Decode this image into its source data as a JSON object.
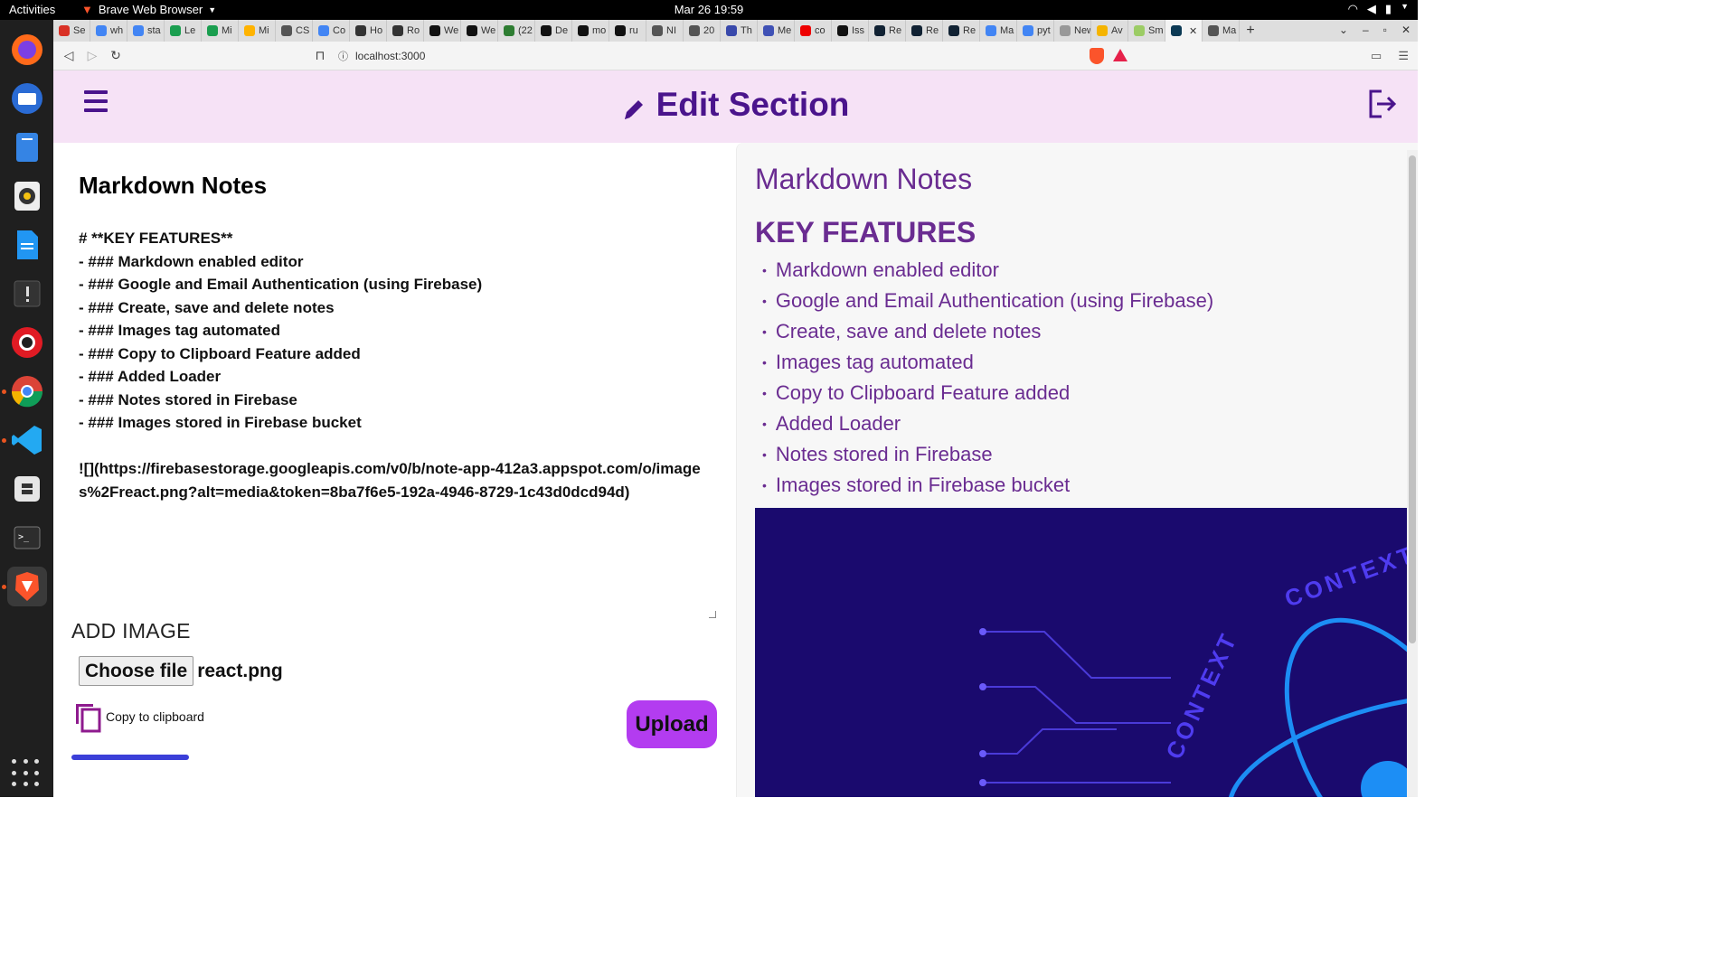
{
  "system_bar": {
    "activities": "Activities",
    "app_name": "Brave Web Browser",
    "clock": "Mar 26  19:59"
  },
  "dock": {
    "items": [
      "firefox-icon",
      "thunderbird-icon",
      "files-icon",
      "rhythmbox-icon",
      "writer-icon",
      "terminal-dark-icon",
      "help-icon",
      "chrome-icon",
      "vscode-icon",
      "software-icon",
      "terminal-icon",
      "brave-icon"
    ]
  },
  "browser": {
    "tabs": [
      "Se",
      "wh",
      "sta",
      "Le",
      "Mi",
      "Mi",
      "CS",
      "Co",
      "Ho",
      "Ro",
      "We",
      "We",
      "(22",
      "De",
      "mo",
      "ru",
      "NI",
      "20",
      "Th",
      "Me",
      "co",
      "Iss",
      "Re",
      "Re",
      "Re",
      "Ma",
      "pyt",
      "New T",
      "Av",
      "Sm",
      "",
      "Ma"
    ],
    "url": "localhost:3000"
  },
  "header": {
    "title": "Edit Section"
  },
  "editor": {
    "note_title": "Markdown Notes",
    "content": "# **KEY FEATURES**\n- ### Markdown enabled editor\n- ### Google and Email Authentication (using Firebase)\n- ### Create, save and delete notes\n- ### Images tag automated\n- ### Copy to Clipboard Feature added\n- ### Added Loader\n- ### Notes stored in Firebase\n- ### Images stored in Firebase bucket\n\n![](https://firebasestorage.googleapis.com/v0/b/note-app-412a3.appspot.com/o/images%2Freact.png?alt=media&token=8ba7f6e5-192a-4946-8729-1c43d0dcd94d)",
    "add_image_label": "ADD IMAGE",
    "choose_file_label": "Choose file",
    "file_name": "react.png",
    "copy_label": "Copy to clipboard",
    "upload_label": "Upload",
    "upload_progress": 1.0
  },
  "preview": {
    "title": "Markdown Notes",
    "heading": "KEY FEATURES",
    "items": [
      "Markdown enabled editor",
      "Google and Email Authentication (using Firebase)",
      "Create, save and delete notes",
      "Images tag automated",
      "Copy to Clipboard Feature added",
      "Added Loader",
      "Notes stored in Firebase",
      "Images stored in Firebase bucket"
    ],
    "image_text": "CONTEXT · CONTEXT"
  },
  "colors": {
    "header_bg": "#f6e2f6",
    "accent_purple": "#4a148c",
    "preview_text": "#6a2c91",
    "upload_button": "#b33cf0",
    "progress": "#3b3fd8"
  }
}
